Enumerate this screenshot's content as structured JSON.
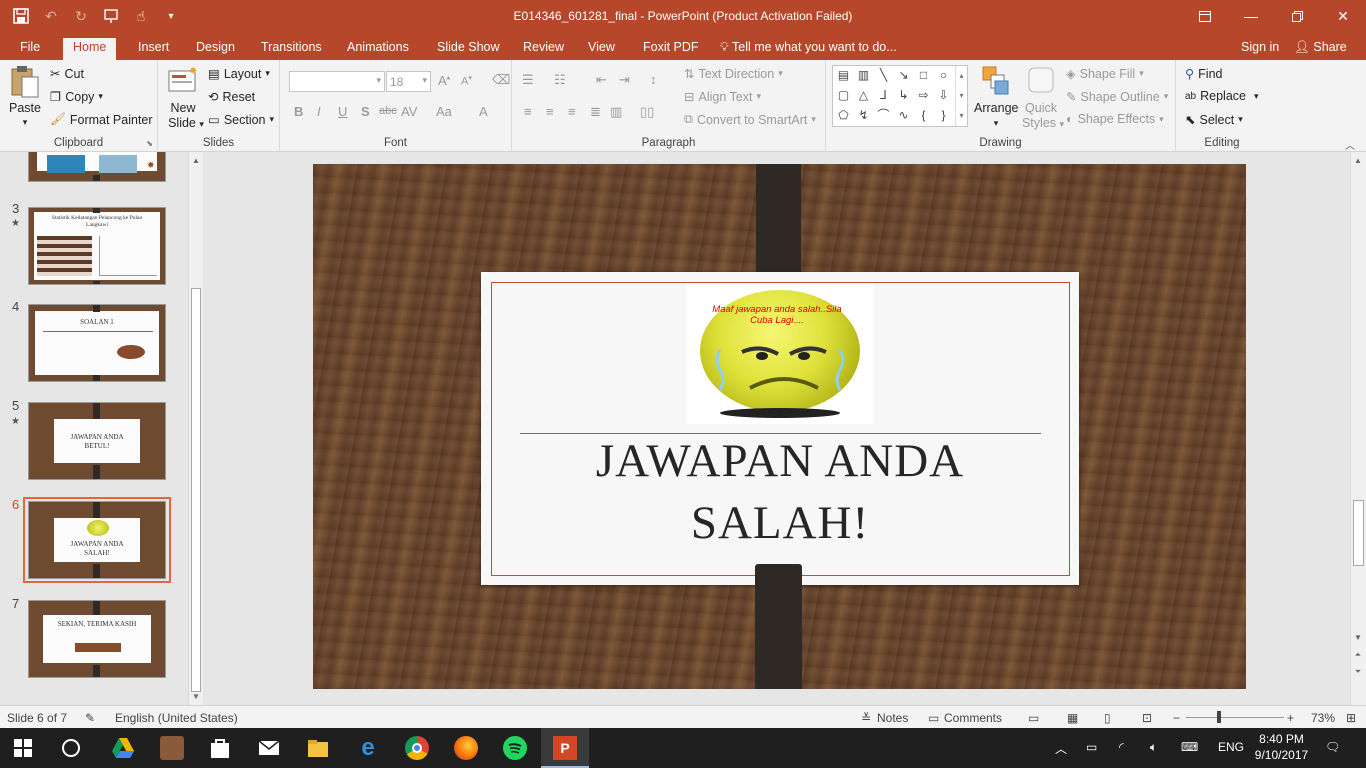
{
  "window": {
    "title": "E014346_601281_final - PowerPoint (Product Activation Failed)"
  },
  "tabs": [
    {
      "label": "File"
    },
    {
      "label": "Home"
    },
    {
      "label": "Insert"
    },
    {
      "label": "Design"
    },
    {
      "label": "Transitions"
    },
    {
      "label": "Animations"
    },
    {
      "label": "Slide Show"
    },
    {
      "label": "Review"
    },
    {
      "label": "View"
    },
    {
      "label": "Foxit PDF"
    }
  ],
  "tellme": "Tell me what you want to do...",
  "signin": "Sign in",
  "share": "Share",
  "ribbon": {
    "clipboard": {
      "label": "Clipboard",
      "paste": "Paste",
      "cut": "Cut",
      "copy": "Copy",
      "format_painter": "Format Painter"
    },
    "slides": {
      "label": "Slides",
      "new_slide_1": "New",
      "new_slide_2": "Slide",
      "layout": "Layout",
      "reset": "Reset",
      "section": "Section"
    },
    "font": {
      "label": "Font",
      "font_name": "",
      "font_size": "18"
    },
    "paragraph": {
      "label": "Paragraph",
      "text_direction": "Text Direction",
      "align_text": "Align Text",
      "convert_smartart": "Convert to SmartArt"
    },
    "drawing": {
      "label": "Drawing",
      "arrange": "Arrange",
      "quick_styles_1": "Quick",
      "quick_styles_2": "Styles",
      "shape_fill": "Shape Fill",
      "shape_outline": "Shape Outline",
      "shape_effects": "Shape Effects"
    },
    "editing": {
      "label": "Editing",
      "find": "Find",
      "replace": "Replace",
      "select": "Select"
    }
  },
  "thumbnails": [
    {
      "num": "3",
      "title": "Statistik Kedatangan Pelancong ke Pulau Langkawi",
      "star": true
    },
    {
      "num": "4",
      "title": "SOALAN 1",
      "star": false
    },
    {
      "num": "5",
      "title": "JAWAPAN ANDA BETUL!",
      "star": true
    },
    {
      "num": "6",
      "title": "JAWAPAN ANDA SALAH!",
      "star": false
    },
    {
      "num": "7",
      "title": "SEKIAN, TERIMA KASIH",
      "star": false
    }
  ],
  "slide": {
    "title": "JAWAPAN ANDA SALAH!",
    "image_caption": "Maaf jawapan anda salah..Sila Cuba Lagi...."
  },
  "status": {
    "slide_of": "Slide 6 of 7",
    "language": "English (United States)",
    "notes": "Notes",
    "comments": "Comments",
    "zoom": "73%"
  },
  "taskbar": {
    "lang": "ENG",
    "time": "8:40 PM",
    "date": "9/10/2017"
  },
  "colors": {
    "accent": "#b7472a",
    "selected_thumb": "#e2673f",
    "title_rule": "#c0502a"
  }
}
